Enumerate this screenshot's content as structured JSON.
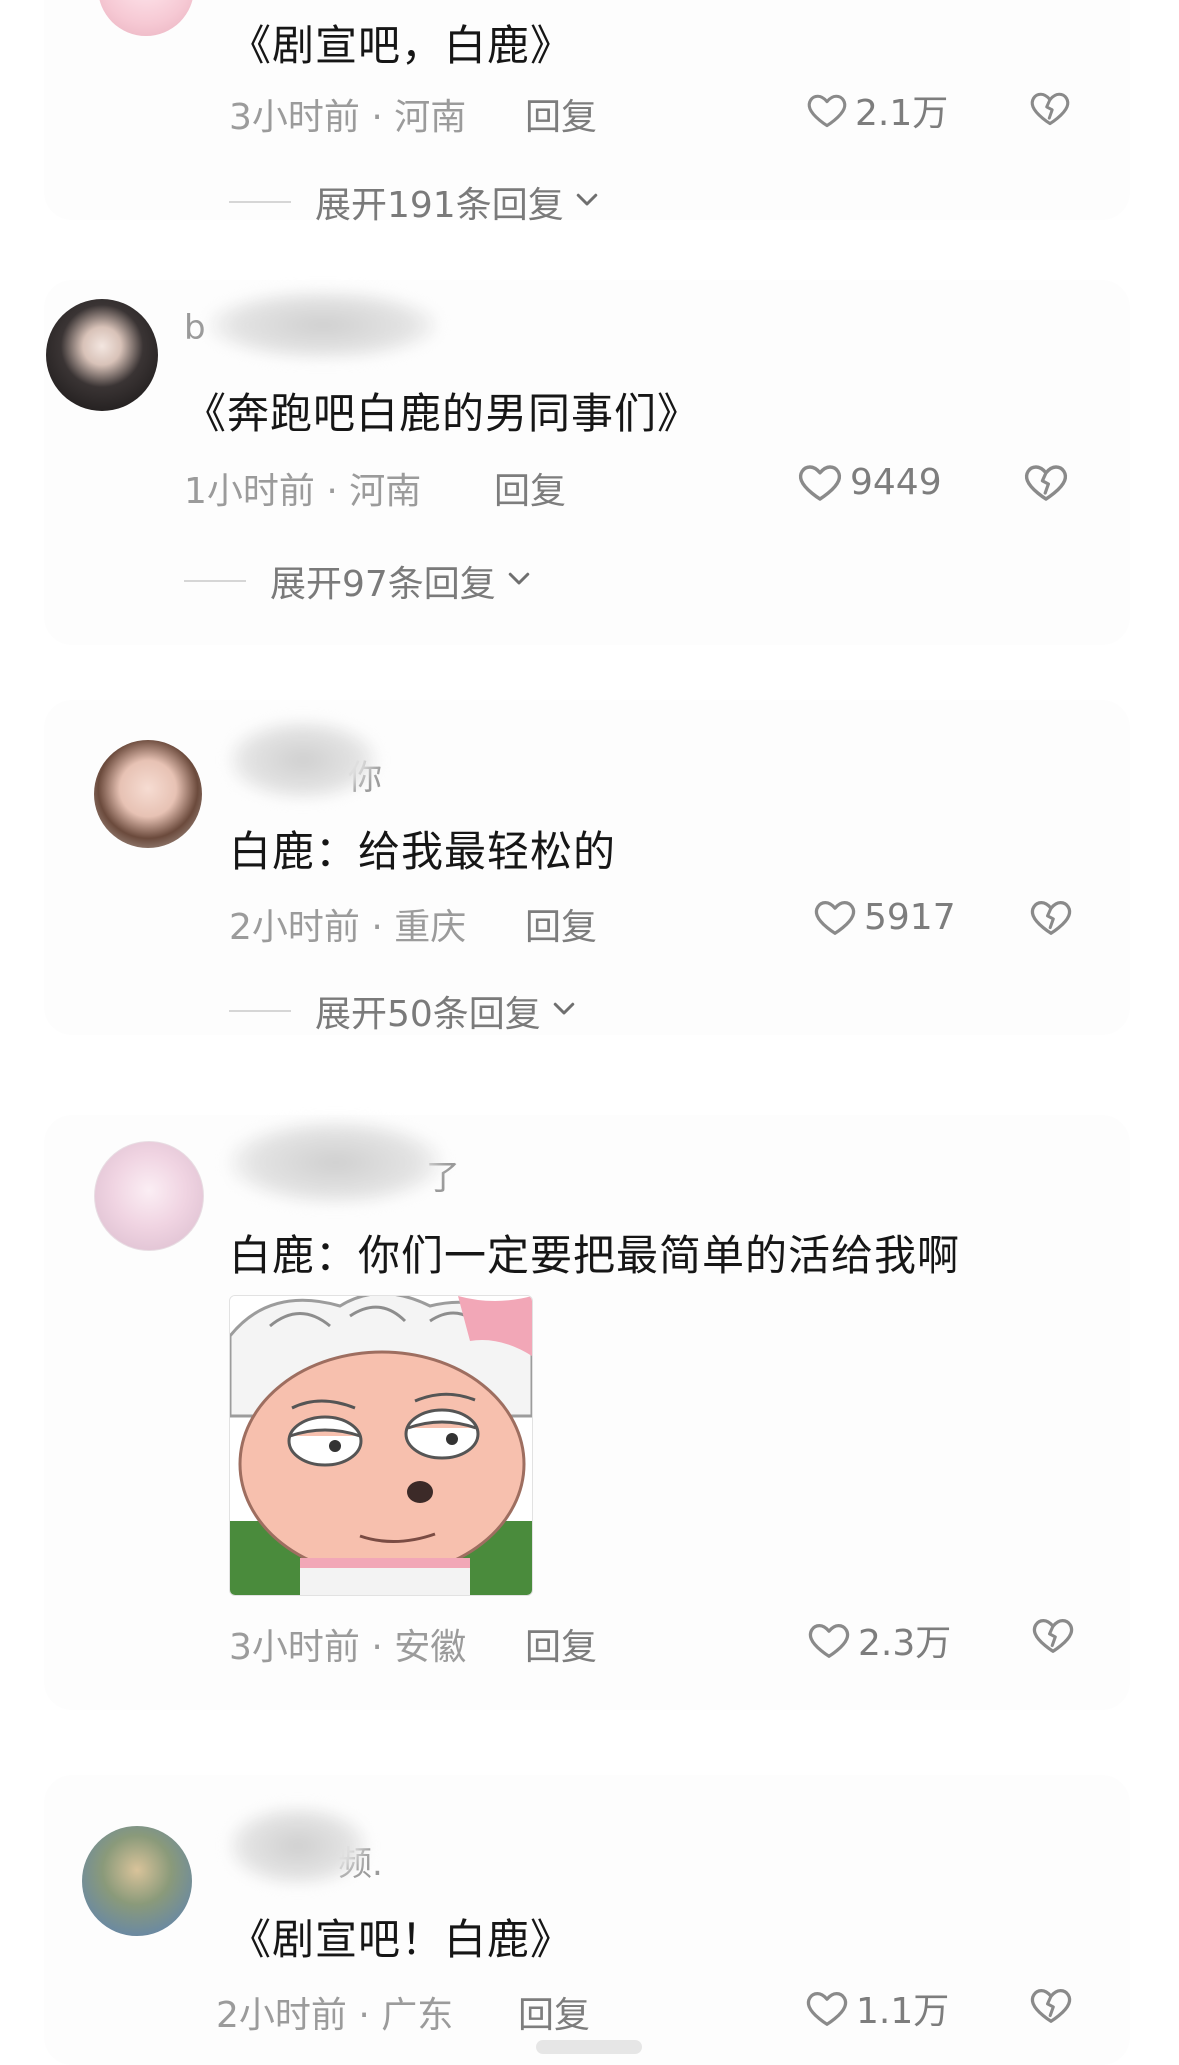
{
  "comments": [
    {
      "username": "",
      "text": "《剧宣吧，白鹿》",
      "time_location": "3小时前 · 河南",
      "reply_label": "回复",
      "likes": "2.1万",
      "expand_label": "展开191条回复"
    },
    {
      "username": "b",
      "text": "《奔跑吧白鹿的男同事们》",
      "time_location": "1小时前 · 河南",
      "reply_label": "回复",
      "likes": "9449",
      "expand_label": "展开97条回复"
    },
    {
      "username": "你",
      "text": "白鹿：给我最轻松的",
      "time_location": "2小时前 · 重庆",
      "reply_label": "回复",
      "likes": "5917",
      "expand_label": "展开50条回复"
    },
    {
      "username": "了",
      "text": "白鹿：你们一定要把最简单的活给我啊",
      "time_location": "3小时前 · 安徽",
      "reply_label": "回复",
      "likes": "2.3万"
    },
    {
      "username": "频.",
      "text": "《剧宣吧！白鹿》",
      "time_location": "2小时前 · 广东",
      "reply_label": "回复",
      "likes": "1.1万"
    }
  ],
  "icons": {
    "like": "heart-outline-icon",
    "dislike": "broken-heart-icon",
    "expand": "chevron-down-icon"
  },
  "colors": {
    "text": "#161616",
    "meta": "#9b9b9b",
    "action": "#7d7d7d",
    "background": "#ffffff"
  }
}
